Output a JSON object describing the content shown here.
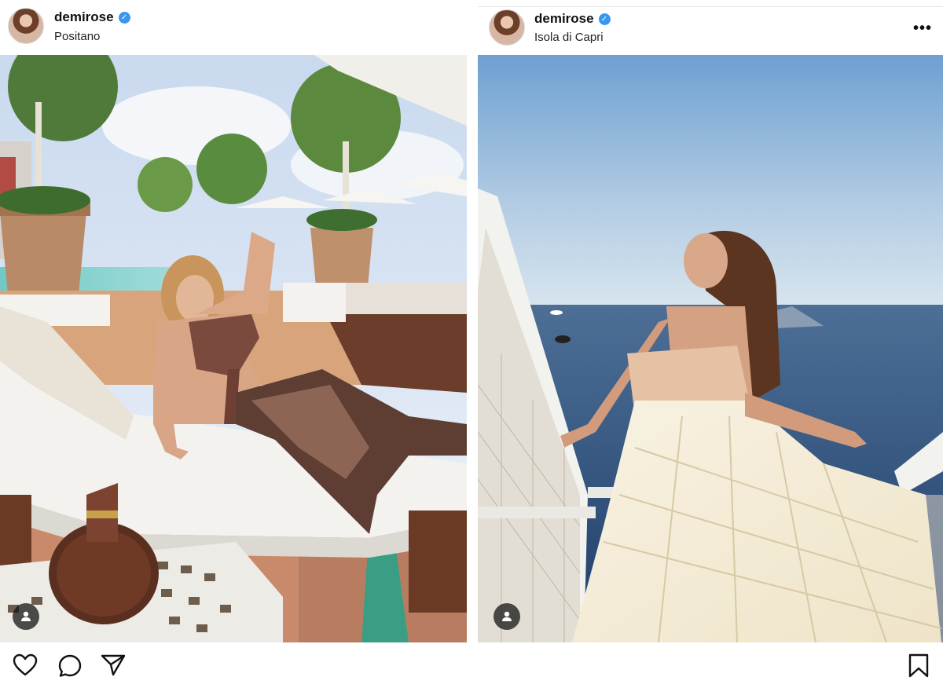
{
  "posts": [
    {
      "username": "demirose",
      "location": "Positano",
      "verified_icon": "verified-badge-icon"
    },
    {
      "username": "demirose",
      "location": "Isola di Capri",
      "verified_icon": "verified-badge-icon",
      "more_label": "•••"
    }
  ],
  "actions": {
    "like_icon": "heart-icon",
    "comment_icon": "comment-icon",
    "share_icon": "share-icon",
    "save_icon": "bookmark-icon"
  },
  "colors": {
    "verified": "#3897f0",
    "text": "#111111",
    "background": "#ffffff"
  }
}
